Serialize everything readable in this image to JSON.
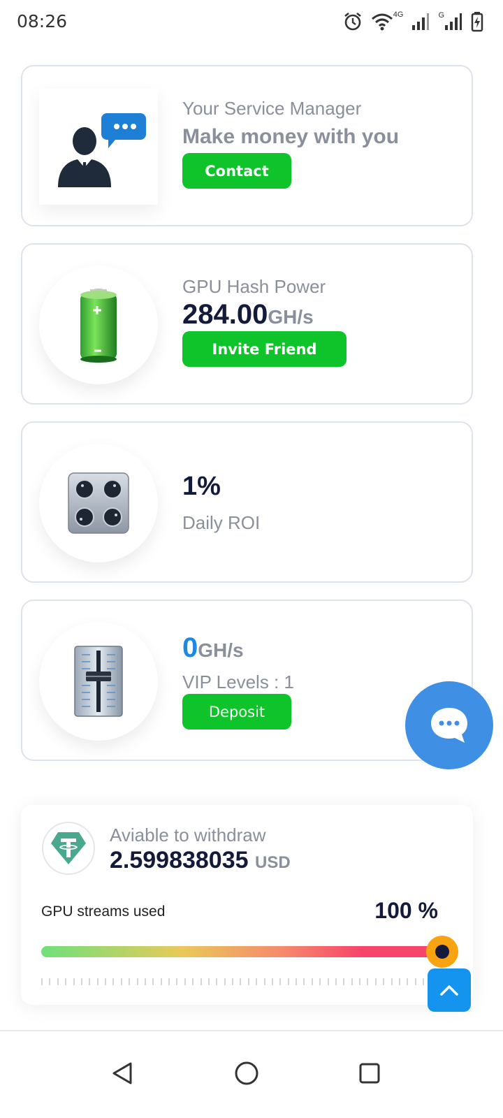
{
  "status_bar": {
    "time": "08:26",
    "icons": [
      "alarm-icon",
      "wifi-icon",
      "signal-4g-icon",
      "signal-g-icon",
      "battery-charging-icon"
    ],
    "net_label_1": "4G",
    "net_label_2": "G"
  },
  "cards": {
    "service_manager": {
      "title": "Your Service Manager",
      "subtitle": "Make money with you",
      "button_label": "Contact",
      "icon": "manager-avatar-icon"
    },
    "hash_power": {
      "title": "GPU Hash Power",
      "value": "284.00",
      "unit": "GH/s",
      "button_label": "Invite Friend",
      "icon": "battery-icon"
    },
    "roi": {
      "value": "1%",
      "label": "Daily ROI",
      "icon": "control-knobs-icon"
    },
    "vip": {
      "value": "0",
      "unit": "GH/s",
      "label": "VIP Levels : 1",
      "button_label": "Deposit",
      "icon": "slider-fader-icon"
    }
  },
  "withdraw": {
    "label": "Aviable to withdraw",
    "amount": "2.599838035",
    "currency": "USD",
    "icon": "tether-usdt-icon",
    "streams_label": "GPU streams used",
    "streams_percent_text": "100 %",
    "streams_used_fraction": 1.0
  },
  "colors": {
    "green_button": "#0fc42b",
    "chat_blue": "#3f8fe4",
    "scroll_top_blue": "#1594ef",
    "vip_value_blue": "#1e88e5",
    "thumb_orange": "#f7a312"
  },
  "nav": {
    "items": [
      "back-icon",
      "home-icon",
      "recents-icon"
    ]
  }
}
